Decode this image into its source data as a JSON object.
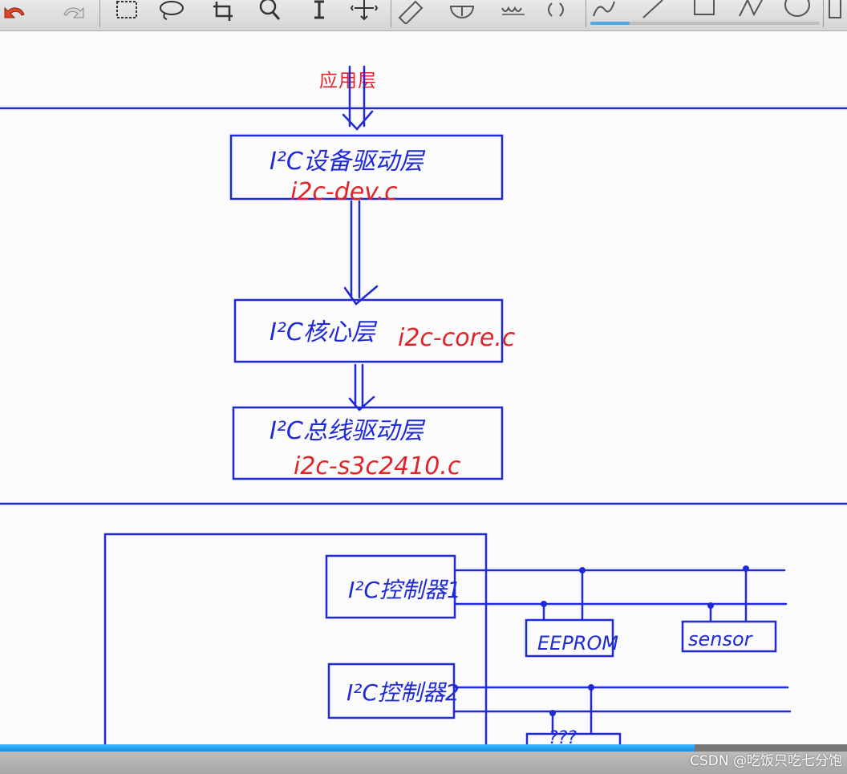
{
  "toolbar": {
    "tools": [
      "undo-icon",
      "redo-icon",
      "select-rectangle-icon",
      "lasso-icon",
      "crop-icon",
      "zoom-icon",
      "text-cursor-icon",
      "move-icon",
      "ruler-icon",
      "eraser-icon",
      "protractor-icon",
      "wave-icon",
      "curve-icon",
      "pen-icon",
      "line-icon",
      "rectangle-icon",
      "polyline-icon",
      "ellipse-icon",
      "more-icon"
    ],
    "stroke_width_level": 0.17
  },
  "canvas": {
    "app_layer_label": "应用层",
    "boxes": {
      "device_driver": {
        "title": "I²C设备驱动层",
        "file": "i2c-dev.c"
      },
      "core": {
        "title": "I²C核心层",
        "file": "i2c-core.c"
      },
      "bus_driver": {
        "title": "I²C总线驱动层",
        "file": "i2c-s3c2410.c"
      }
    },
    "hardware": {
      "controller_1": "I²C控制器1",
      "controller_2": "I²C控制器2",
      "eeprom": "EEPROM",
      "sensor": "sensor",
      "device_3": "???"
    },
    "colors": {
      "ink_blue": "#1f2ad6",
      "ink_red": "#e0242a"
    }
  },
  "playback": {
    "progress_fraction": 0.82
  },
  "watermark": "CSDN @吃饭只吃七分饱"
}
